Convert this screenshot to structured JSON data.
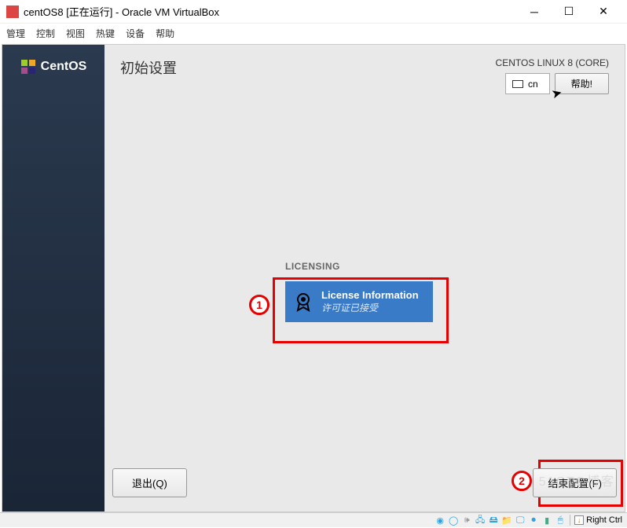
{
  "window": {
    "title": "centOS8 [正在运行] - Oracle VM VirtualBox"
  },
  "menubar": {
    "items": [
      "管理",
      "控制",
      "视图",
      "热键",
      "设备",
      "帮助"
    ]
  },
  "sidebar": {
    "brand": "CentOS"
  },
  "header": {
    "page_title": "初始设置",
    "distro": "CENTOS LINUX 8 (CORE)",
    "lang": "cn",
    "help_label": "帮助!"
  },
  "licensing": {
    "section_label": "LICENSING",
    "title": "License Information",
    "subtitle": "许可证已接受"
  },
  "footer": {
    "quit_label": "退出(Q)",
    "finish_label": "结束配置(F)"
  },
  "annotations": {
    "one": "1",
    "two": "2"
  },
  "statusbar": {
    "hostkey": "Right Ctrl"
  },
  "watermark": "51CTO博客"
}
